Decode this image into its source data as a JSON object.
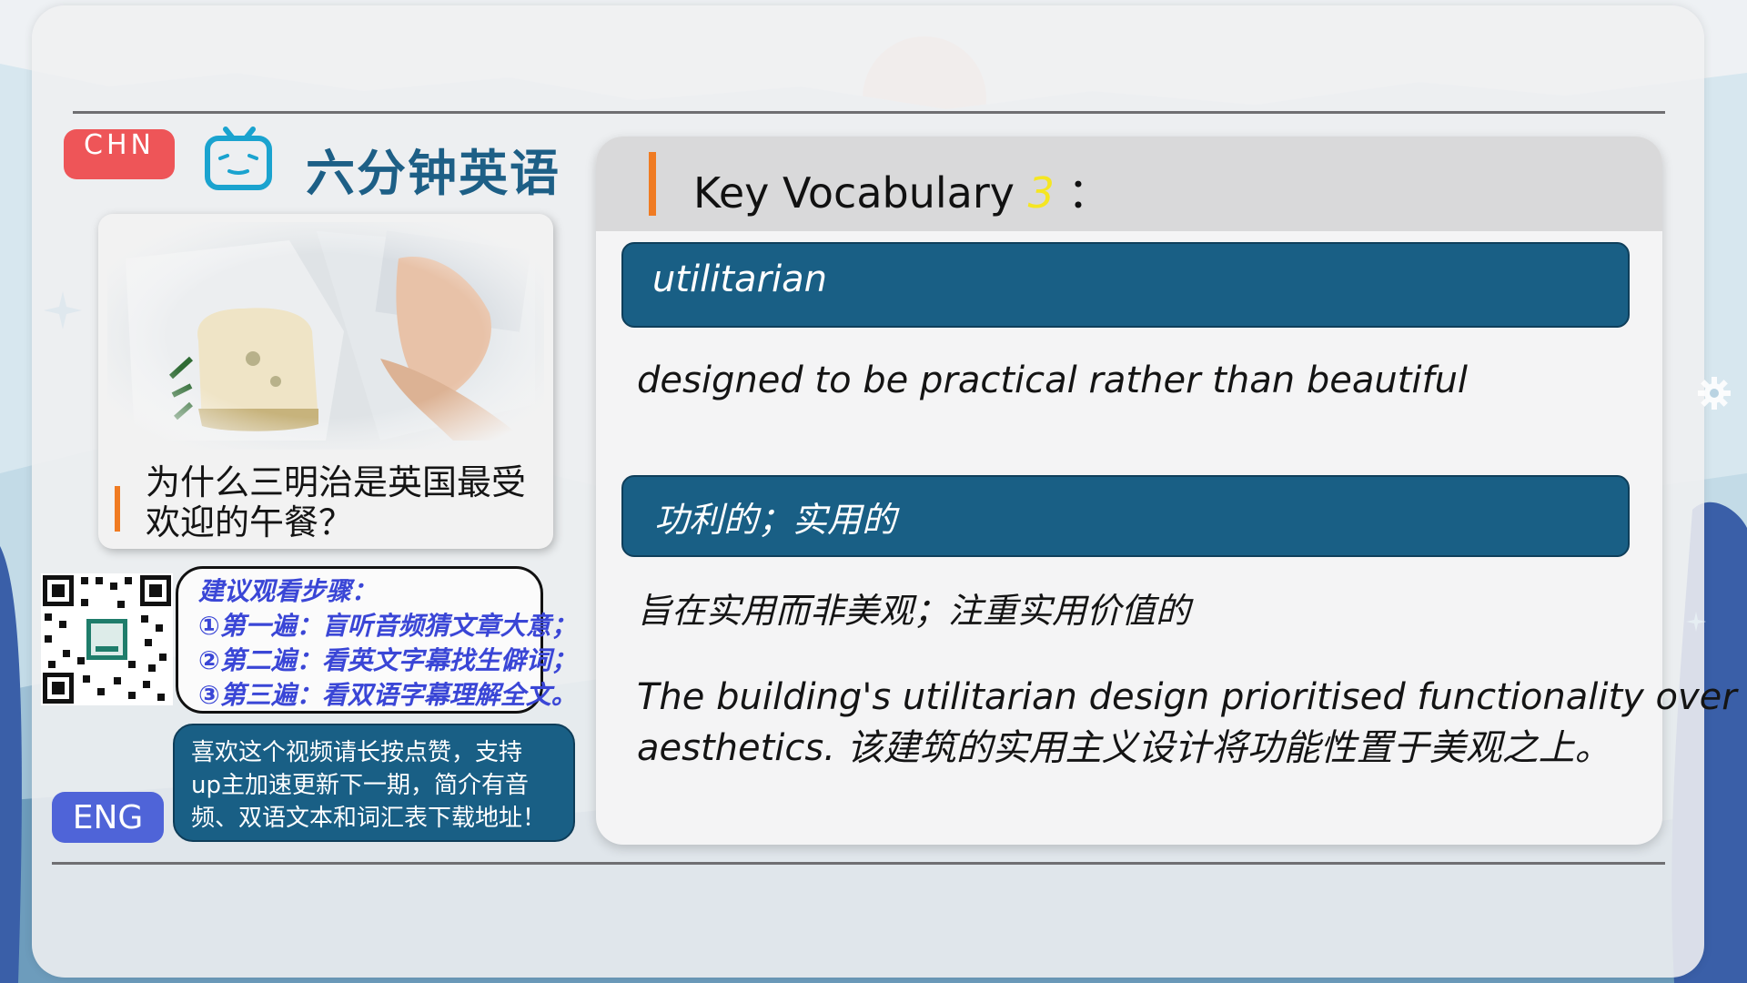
{
  "header": {
    "chn_label": "CHN",
    "app_title": "六分钟英语"
  },
  "story": {
    "title": "为什么三明治是英国最受欢迎的午餐？"
  },
  "steps": {
    "heading": "建议观看步骤：",
    "lines": [
      "①第一遍：盲听音频猜文章大意；",
      "②第二遍：看英文字幕找生僻词；",
      "③第三遍：看双语字幕理解全文。"
    ]
  },
  "promo": {
    "lines": [
      "喜欢这个视频请长按点赞，支持",
      "up主加速更新下一期，简介有音",
      "频、双语文本和词汇表下载地址！"
    ]
  },
  "footer": {
    "eng_label": "ENG"
  },
  "vocab": {
    "header_label": "Key Vocabulary",
    "number": "3",
    "colon": "：",
    "word": "utilitarian",
    "definition_en": "designed to be practical rather than beautiful",
    "translation": "功利的；实用的",
    "definition_cn": "旨在实用而非美观；注重实用价值的",
    "example_line1": "The building's utilitarian design prioritised functionality over",
    "example_line2": "aesthetics. 该建筑的实用主义设计将功能性置于美观之上。"
  },
  "colors": {
    "accent_orange": "#f07b22",
    "brand_teal": "#195f85",
    "chn_red": "#ee5558",
    "eng_blue": "#4f64d8",
    "number_yellow": "#f5e622",
    "steps_blue": "#3a46d6"
  },
  "icons": {
    "logo": "tv-icon",
    "qr": "qr-code",
    "gear": "gear-icon"
  }
}
